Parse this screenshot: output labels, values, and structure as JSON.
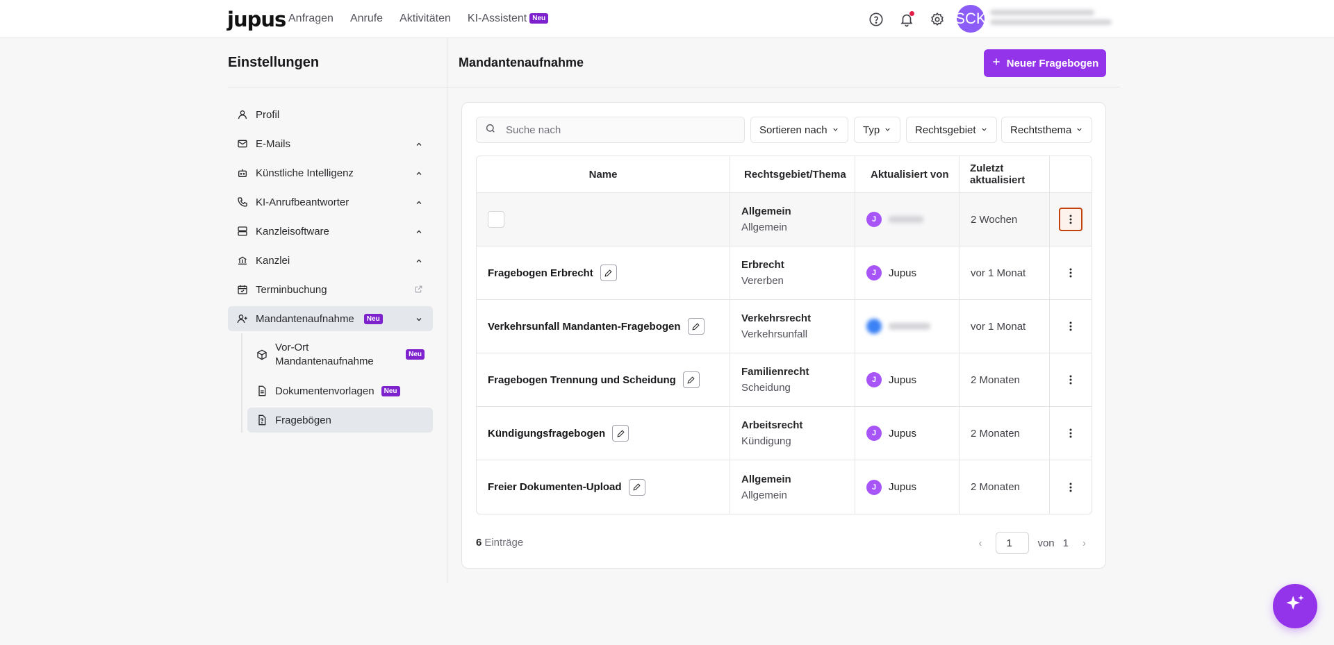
{
  "app": {
    "logo": "jupus"
  },
  "nav": [
    {
      "label": "Anfragen"
    },
    {
      "label": "Anrufe"
    },
    {
      "label": "Aktivitäten"
    },
    {
      "label": "KI-Assistent",
      "badge": "Neu"
    }
  ],
  "header": {
    "avatar_initials": "SCK"
  },
  "settings": {
    "title": "Einstellungen",
    "items": [
      {
        "label": "Profil",
        "icon": "user-icon"
      },
      {
        "label": "E-Mails",
        "icon": "mail-icon"
      },
      {
        "label": "Künstliche Intelligenz",
        "icon": "bot-icon"
      },
      {
        "label": "KI-Anrufbeantworter",
        "icon": "phone-icon"
      },
      {
        "label": "Kanzleisoftware",
        "icon": "server-icon"
      },
      {
        "label": "Kanzlei",
        "icon": "building-icon"
      },
      {
        "label": "Terminbuchung",
        "icon": "calendar-icon"
      },
      {
        "label": "Mandantenaufnahme",
        "icon": "user-plus-icon",
        "badge": "Neu"
      }
    ],
    "subitems": [
      {
        "label": "Vor-Ort Mandantenaufnahme",
        "badge": "Neu"
      },
      {
        "label": "Dokumentenvorlagen",
        "badge": "Neu"
      },
      {
        "label": "Fragebögen"
      }
    ]
  },
  "main": {
    "title": "Mandantenaufnahme",
    "new_button": "Neuer Fragebogen",
    "search_placeholder": "Suche nach",
    "filters": [
      "Sortieren nach",
      "Typ",
      "Rechtsgebiet",
      "Rechtsthema"
    ],
    "columns": [
      "Name",
      "Rechtsgebiet/Thema",
      "Aktualisiert von",
      "Zuletzt aktualisiert"
    ],
    "rows": [
      {
        "name": "",
        "area": "Allgemein",
        "topic": "Allgemein",
        "user": "",
        "user_initial": "J",
        "updated": "2 Wochen"
      },
      {
        "name": "Fragebogen Erbrecht",
        "area": "Erbrecht",
        "topic": "Vererben",
        "user": "Jupus",
        "user_initial": "J",
        "updated": "vor 1 Monat"
      },
      {
        "name": "Verkehrsunfall Mandanten-Fragebogen",
        "area": "Verkehrsrecht",
        "topic": "Verkehrsunfall",
        "user": "",
        "user_initial": "",
        "updated": "vor 1 Monat"
      },
      {
        "name": "Fragebogen Trennung und Scheidung",
        "area": "Familienrecht",
        "topic": "Scheidung",
        "user": "Jupus",
        "user_initial": "J",
        "updated": "2 Monaten"
      },
      {
        "name": "Kündigungsfragebogen",
        "area": "Arbeitsrecht",
        "topic": "Kündigung",
        "user": "Jupus",
        "user_initial": "J",
        "updated": "2 Monaten"
      },
      {
        "name": "Freier Dokumenten-Upload",
        "area": "Allgemein",
        "topic": "Allgemein",
        "user": "Jupus",
        "user_initial": "J",
        "updated": "2 Monaten"
      }
    ],
    "count": "6",
    "count_label": "Einträge",
    "page": "1",
    "of_label": "von",
    "total_pages": "1"
  },
  "colors": {
    "accent": "#9333ea",
    "badge": "#7e22ce",
    "focus": "#c2410c"
  }
}
